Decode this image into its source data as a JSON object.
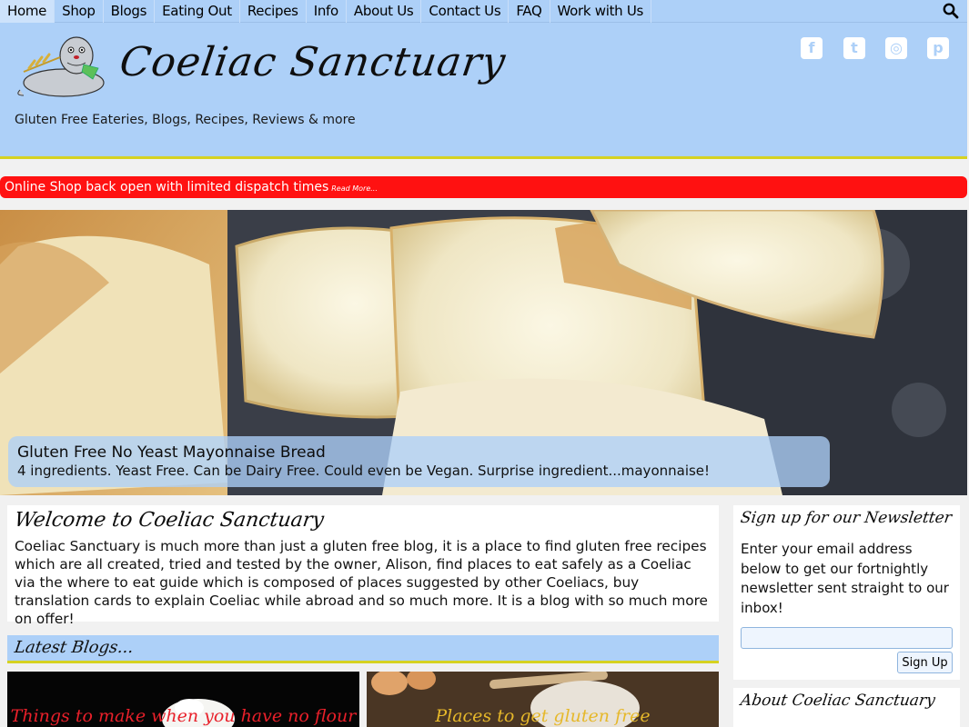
{
  "nav": {
    "items": [
      {
        "label": "Home"
      },
      {
        "label": "Shop"
      },
      {
        "label": "Blogs"
      },
      {
        "label": "Eating Out"
      },
      {
        "label": "Recipes"
      },
      {
        "label": "Info"
      },
      {
        "label": "About Us"
      },
      {
        "label": "Contact Us"
      },
      {
        "label": "FAQ"
      },
      {
        "label": "Work with Us"
      }
    ],
    "search_icon": "search-icon"
  },
  "header": {
    "title": "Coeliac Sanctuary",
    "tagline": "Gluten Free Eateries, Blogs, Recipes, Reviews & more",
    "social": [
      {
        "icon": "facebook-icon",
        "glyph": "f"
      },
      {
        "icon": "twitter-icon",
        "glyph": "t"
      },
      {
        "icon": "instagram-icon",
        "glyph": "◎"
      },
      {
        "icon": "pinterest-icon",
        "glyph": "p"
      }
    ]
  },
  "alert": {
    "text": "Online Shop back open with limited dispatch times",
    "more": "Read More..."
  },
  "hero": {
    "title": "Gluten Free No Yeast Mayonnaise Bread",
    "subtitle": "4 ingredients. Yeast Free. Can be Dairy Free. Could even be Vegan. Surprise ingredient...mayonnaise!"
  },
  "welcome": {
    "title": "Welcome to Coeliac Sanctuary",
    "text": "Coeliac Sanctuary is much more than just a gluten free blog, it is a place to find gluten free recipes which are all created, tried and tested by the owner, Alison, find places to eat safely as a Coeliac via the where to eat guide which is composed of places suggested by other Coeliacs, buy translation cards to explain Coeliac while abroad and so much more. It is a blog with so much more on offer!"
  },
  "latest": {
    "title": "Latest Blogs...",
    "cards": [
      {
        "text": "Things to make when you have no flour"
      },
      {
        "text": "Places to get gluten free"
      }
    ]
  },
  "newsletter": {
    "title": "Sign up for our Newsletter",
    "text": "Enter your email address below to get our fortnightly newsletter sent straight to our inbox!",
    "button": "Sign Up"
  },
  "about": {
    "title": "About Coeliac Sanctuary"
  },
  "colors": {
    "nav_bg": "#add0f8",
    "accent_yellow": "#d6d221",
    "alert_red": "#ff1111"
  }
}
